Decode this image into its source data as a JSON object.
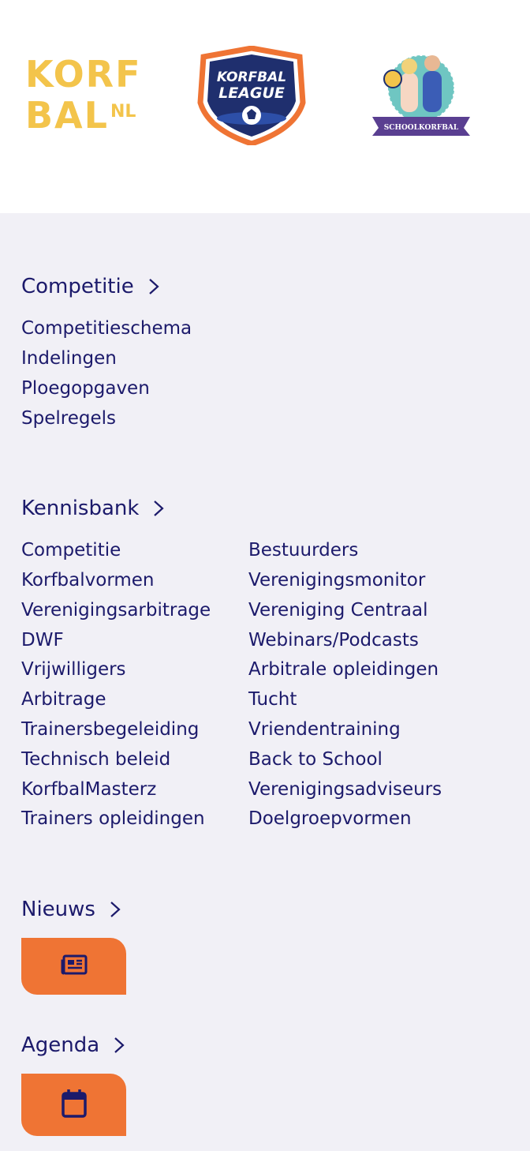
{
  "logos": {
    "korfbal": {
      "line1": "KORF",
      "line2": "BAL",
      "suffix": "NL"
    },
    "league": {
      "line1": "KORFBAL",
      "line2": "LEAGUE"
    },
    "school": {
      "banner": "SCHOOLKORFBAL"
    }
  },
  "competitie": {
    "title": "Competitie",
    "links": [
      "Competitieschema",
      "Indelingen",
      "Ploegopgaven",
      "Spelregels"
    ]
  },
  "kennisbank": {
    "title": "Kennisbank",
    "left": [
      "Competitie",
      "Korfbalvormen",
      "Verenigingsarbitrage",
      "DWF",
      "Vrijwilligers",
      "Arbitrage",
      "Trainersbegeleiding",
      "Technisch beleid",
      "KorfbalMasterz",
      "Trainers opleidingen"
    ],
    "right": [
      "Bestuurders",
      "Verenigingsmonitor",
      "Vereniging Centraal",
      "Webinars/Podcasts",
      "Arbitrale opleidingen",
      "Tucht",
      "Vriendentraining",
      "Back to School",
      "Verenigingsadviseurs",
      "Doelgroepvormen"
    ]
  },
  "nieuws": {
    "title": "Nieuws",
    "icon": "newspaper-icon"
  },
  "agenda": {
    "title": "Agenda",
    "icon": "calendar-icon"
  },
  "colors": {
    "navy": "#1c1a6b",
    "orange": "#ef7434",
    "yellow": "#f3c44b",
    "background": "#f1f0f6"
  }
}
